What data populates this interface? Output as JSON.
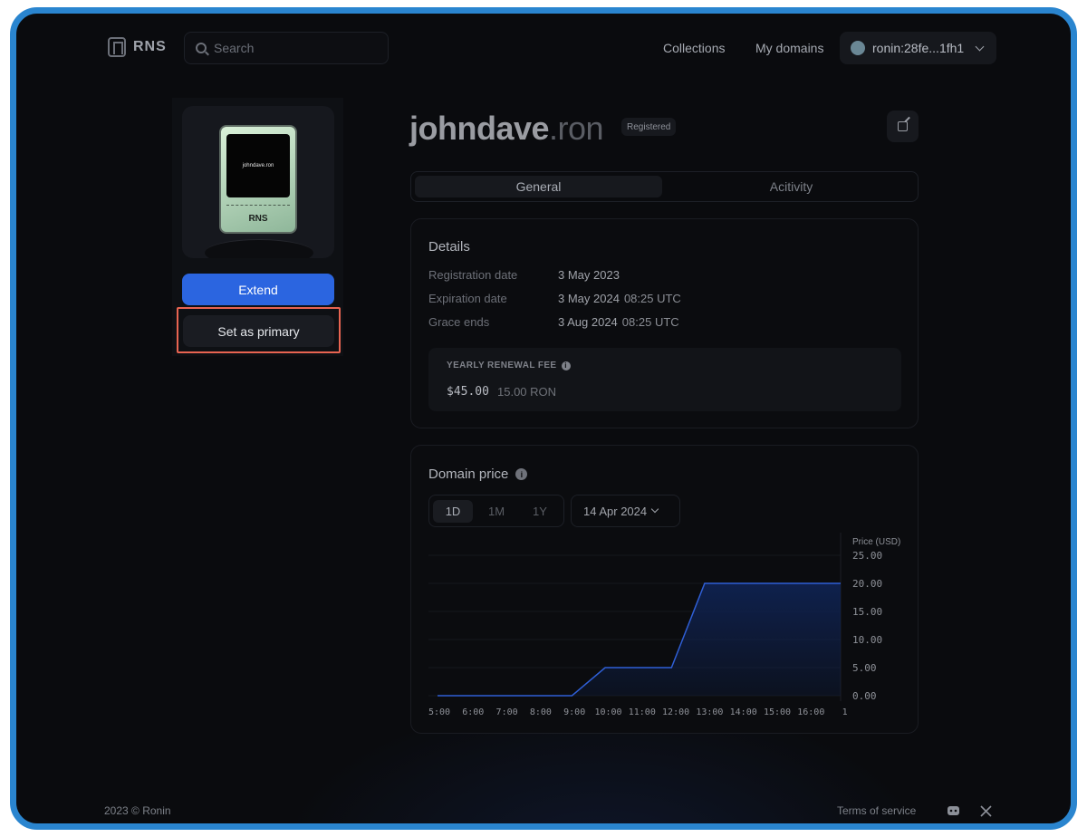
{
  "header": {
    "logo_text": "RNS",
    "search_placeholder": "Search",
    "nav": [
      "Collections",
      "My domains"
    ],
    "wallet": "ronin:28fe...1fh1"
  },
  "nft": {
    "screen_text": "johndave.ron",
    "brand": "RNS"
  },
  "actions": {
    "extend_label": "Extend",
    "primary_label": "Set as primary"
  },
  "domain": {
    "name": "johndave",
    "tld": ".ron",
    "status": "Registered"
  },
  "tabs": [
    "General",
    "Acitivity"
  ],
  "details": {
    "title": "Details",
    "rows": [
      {
        "label": "Registration date",
        "value": "3 May 2023",
        "time": ""
      },
      {
        "label": "Expiration date",
        "value": "3 May 2024",
        "time": "08:25 UTC"
      },
      {
        "label": "Grace ends",
        "value": "3 Aug 2024",
        "time": "08:25 UTC"
      }
    ],
    "fee_label": "YEARLY RENEWAL FEE",
    "fee_usd": "$45.00",
    "fee_ron": "15.00 RON"
  },
  "price": {
    "title": "Domain price",
    "ranges": [
      "1D",
      "1M",
      "1Y"
    ],
    "date": "14 Apr 2024"
  },
  "chart_data": {
    "type": "area",
    "ylabel": "Price (USD)",
    "ylim": [
      0,
      25
    ],
    "yticks": [
      "25.00",
      "20.00",
      "15.00",
      "10.00",
      "5.00",
      "0.00"
    ],
    "xticks": [
      "5:00",
      "6:00",
      "7:00",
      "8:00",
      "9:00",
      "10:00",
      "11:00",
      "12:00",
      "13:00",
      "14:00",
      "15:00",
      "16:00",
      "1"
    ],
    "x": [
      "5:00",
      "9:00",
      "10:00",
      "12:00",
      "13:00",
      "16:00"
    ],
    "values": [
      0,
      0,
      5,
      5,
      20,
      20
    ],
    "line_color": "#2f5fd6",
    "fill_color": "#0f2250"
  },
  "footer": {
    "copyright": "2023 © Ronin",
    "terms": "Terms of service"
  },
  "colors": {
    "accent": "#2b65e0",
    "highlight": "#e86451",
    "frame": "#2a85cf"
  }
}
